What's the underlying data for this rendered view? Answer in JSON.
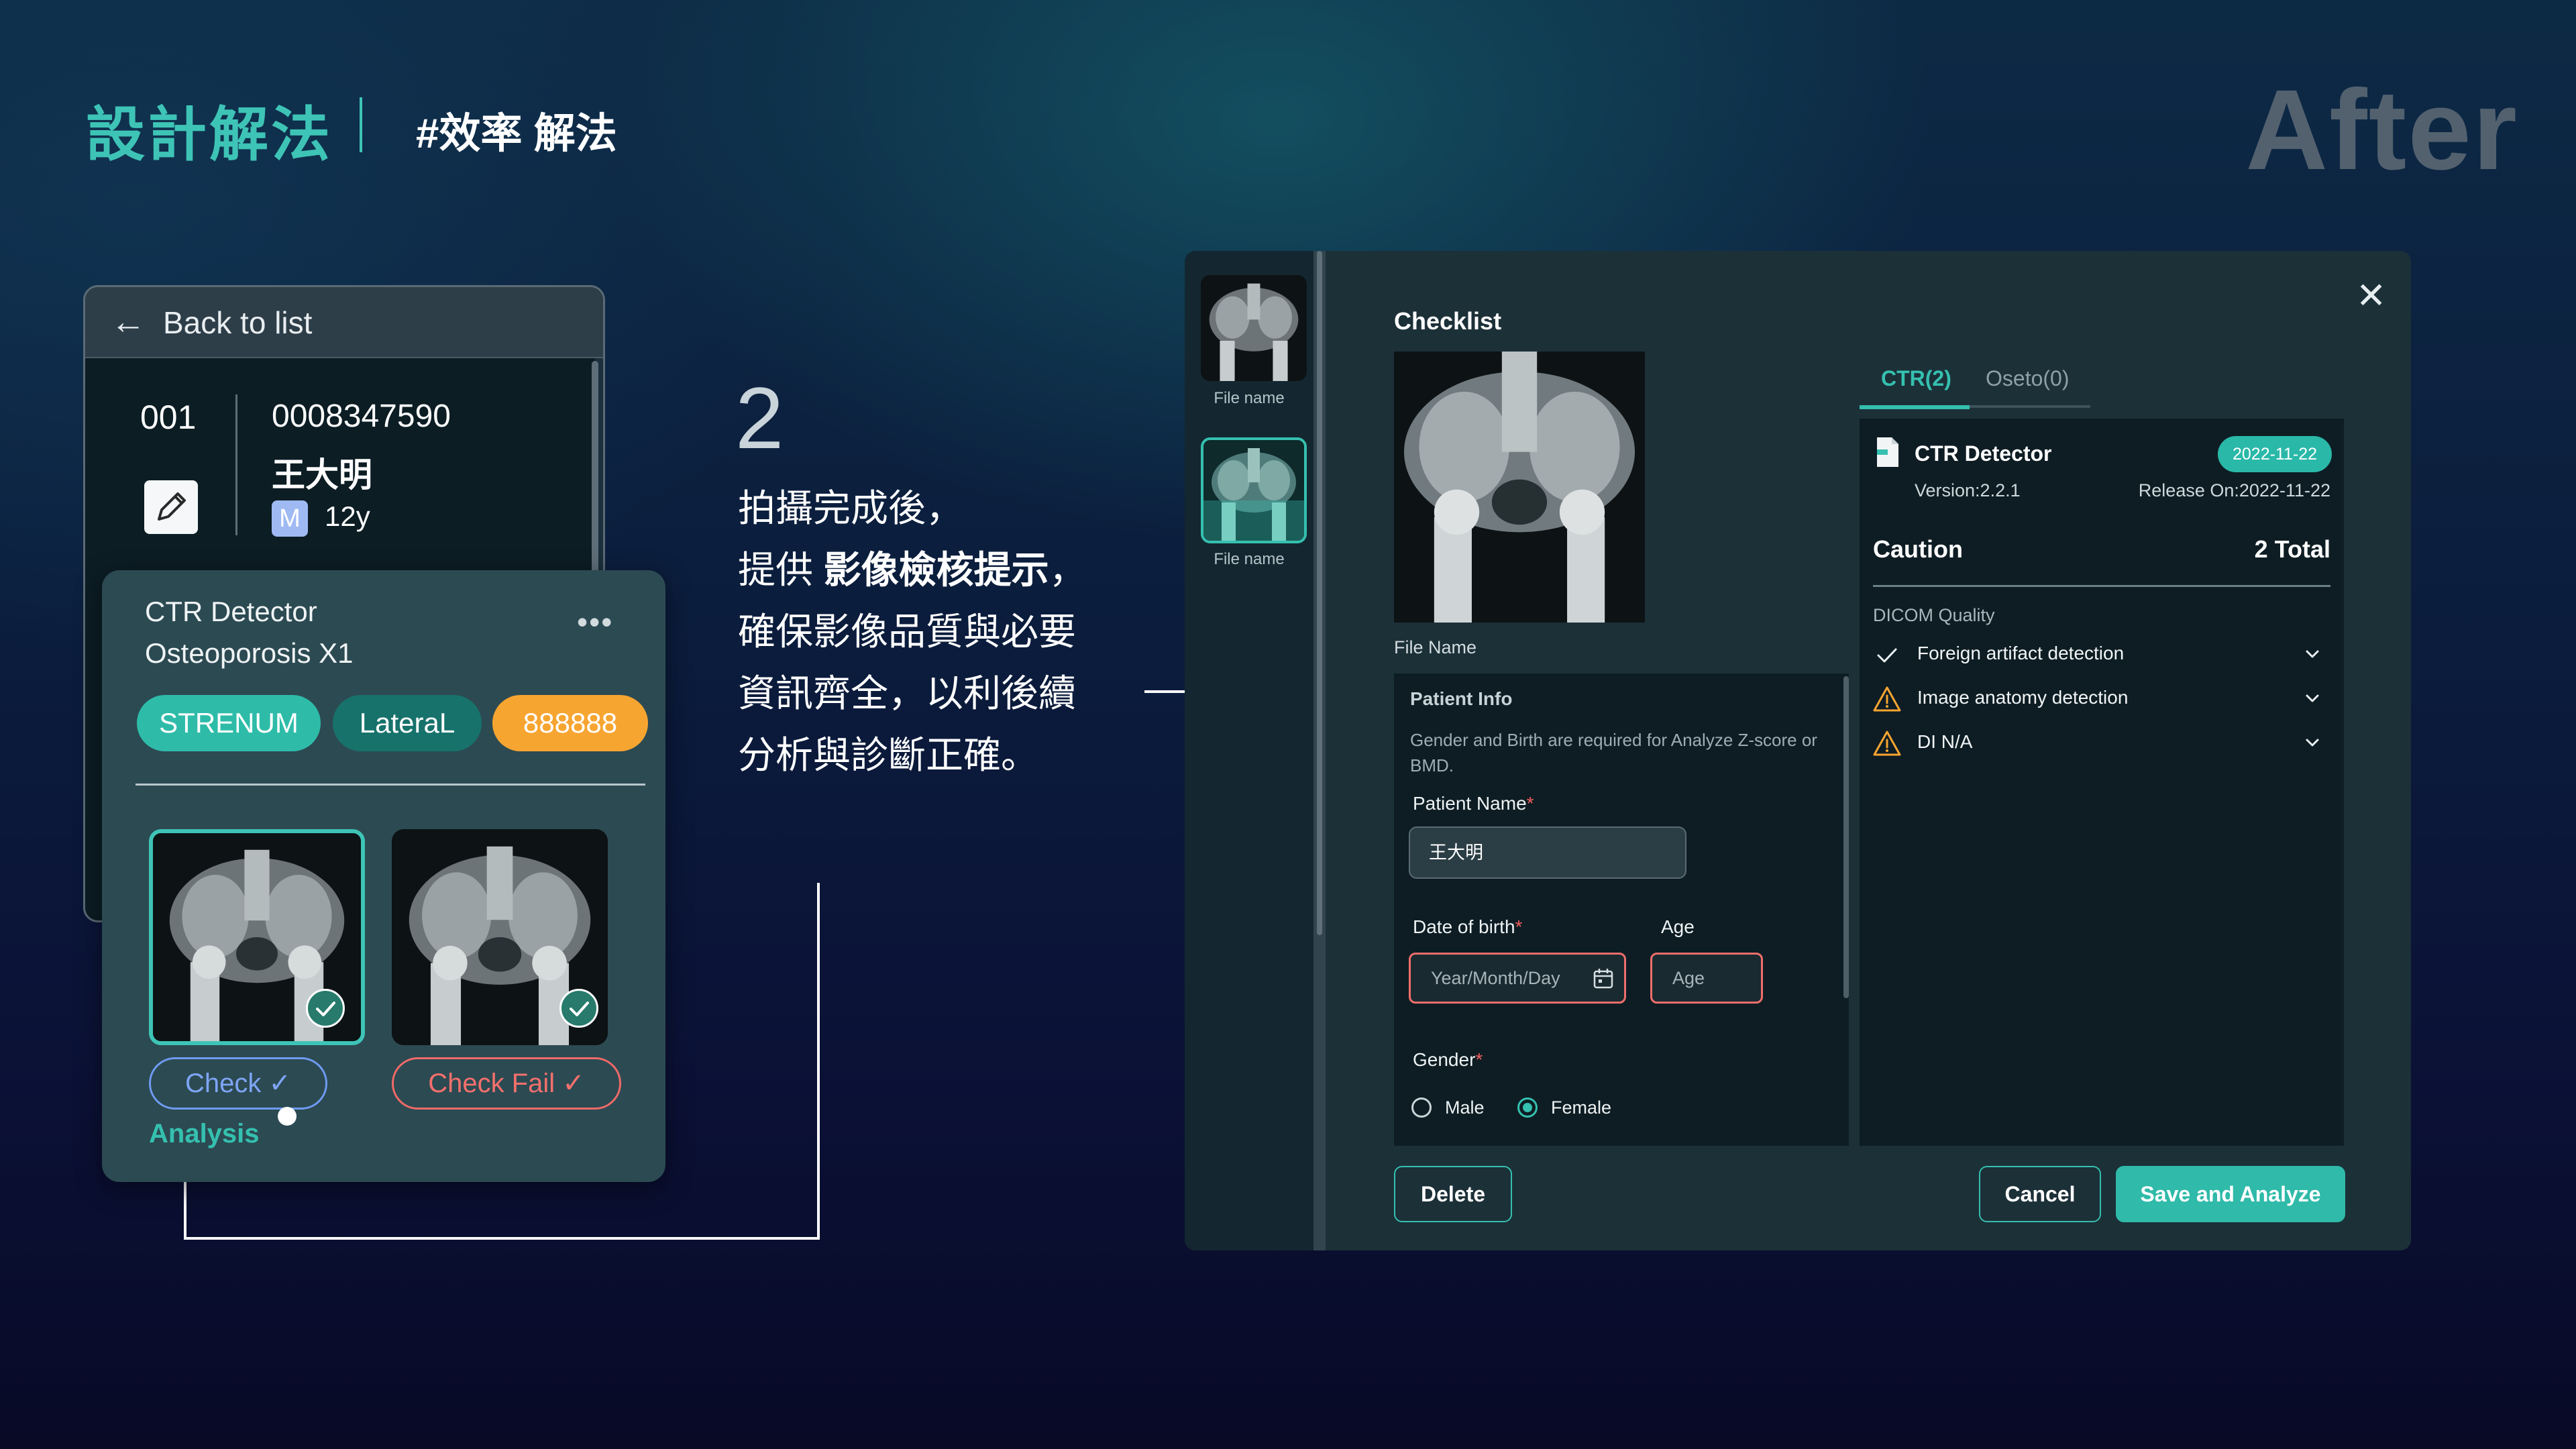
{
  "header": {
    "title": "設計解法",
    "subtitle": "#效率 解法",
    "corner_label": "After"
  },
  "list_card": {
    "back_label": "Back to list",
    "patient_index": "001",
    "patient_number": "0008347590",
    "patient_name": "王大明",
    "sex_badge": "M",
    "age": "12y"
  },
  "detail_card": {
    "line1": "CTR Detector",
    "line2": "Osteoporosis X1",
    "more": "•••",
    "tags": [
      "STRENUM",
      "LateraL",
      "888888"
    ],
    "check_label": "Check",
    "fail_label": "Check Fail",
    "analysis_label": "Analysis"
  },
  "step": {
    "number": "2",
    "line1": "拍攝完成後，",
    "line2_pre": "提供 ",
    "line2_bold": "影像檢核提示",
    "line2_post": "，",
    "line3": "確保影像品質與必要",
    "line4": "資訊齊全，以利後續",
    "line5": "分析與診斷正確。"
  },
  "modal": {
    "side_labels": [
      "File name",
      "File name"
    ],
    "checklist_title": "Checklist",
    "file_name_label": "File Name",
    "close_icon": "close-icon",
    "patient_info": {
      "title": "Patient Info",
      "description": "Gender and Birth are required for Analyze Z-score or BMD.",
      "name_label": "Patient Name",
      "name_value": "王大明",
      "dob_label": "Date of birth",
      "dob_placeholder": "Year/Month/Day",
      "age_label": "Age",
      "age_placeholder": "Age",
      "gender_label": "Gender",
      "male_label": "Male",
      "female_label": "Female",
      "required_mark": "*"
    },
    "tabs": [
      {
        "label": "CTR(2)",
        "active": true
      },
      {
        "label": "Oseto(0)",
        "active": false
      }
    ],
    "detector": {
      "name": "CTR Detector",
      "date_badge": "2022-11-22",
      "version": "Version:2.2.1",
      "release": "Release On:2022-11-22",
      "caution": "Caution",
      "total": "2 Total",
      "section": "DICOM Quality",
      "items": [
        {
          "label": "Foreign artifact detection",
          "status": "pass"
        },
        {
          "label": "Image anatomy detection",
          "status": "warning"
        },
        {
          "label": "DI N/A",
          "status": "warning"
        }
      ]
    },
    "buttons": {
      "delete": "Delete",
      "cancel": "Cancel",
      "save": "Save and Analyze"
    }
  },
  "colors": {
    "accent": "#35c0af",
    "warning": "#f7a531",
    "error": "#f16a68",
    "check_blue": "#7ea5f4"
  }
}
